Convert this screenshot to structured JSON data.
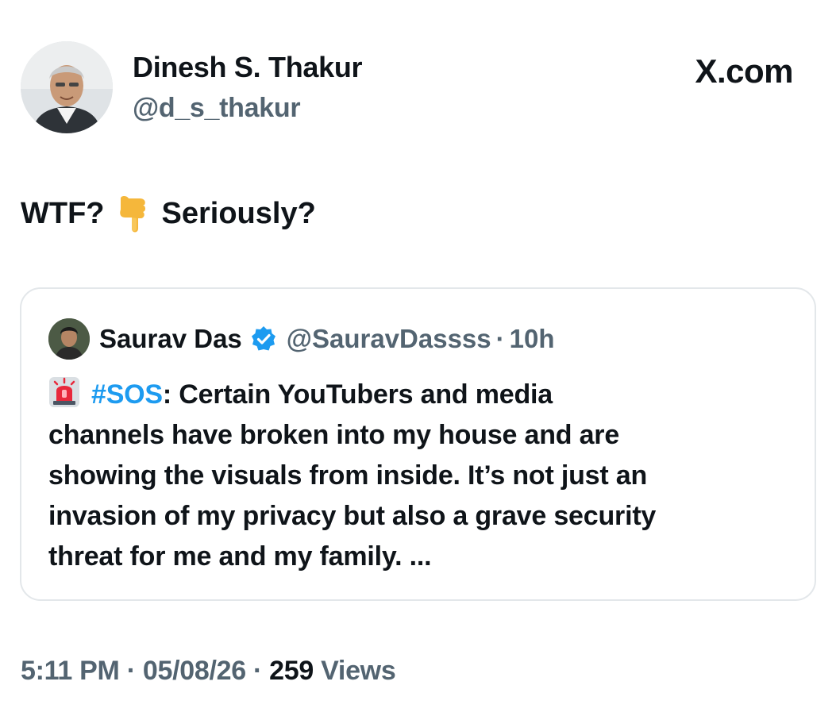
{
  "author": {
    "name": "Dinesh S. Thakur",
    "handle": "@d_s_thakur"
  },
  "site_logo": "X.com",
  "tweet": {
    "text_part1": "WTF?",
    "emoji": "backhand-index-pointing-down",
    "text_part2": "Seriously?"
  },
  "quoted": {
    "name": "Saurav Das",
    "verified": true,
    "handle": "@SauravDassss",
    "separator": "·",
    "time": "10h",
    "body": {
      "emoji": "police-car-light",
      "hashtag": "#SOS",
      "line1_rest": ": Certain YouTubers and media",
      "line2": "channels have broken into my house and are",
      "line3": "showing the visuals from inside. It’s not just an",
      "line4": "invasion of my privacy but also a grave security",
      "line5": "threat for me and my family. ..."
    }
  },
  "meta": {
    "time": "5:11 PM",
    "sep1": "·",
    "date": "05/08/26",
    "sep2": "·",
    "views_count": "259",
    "views_label": "Views"
  },
  "colors": {
    "text": "#0f1419",
    "secondary": "#536471",
    "link": "#1d9bf0",
    "border": "#e3e7ea"
  }
}
